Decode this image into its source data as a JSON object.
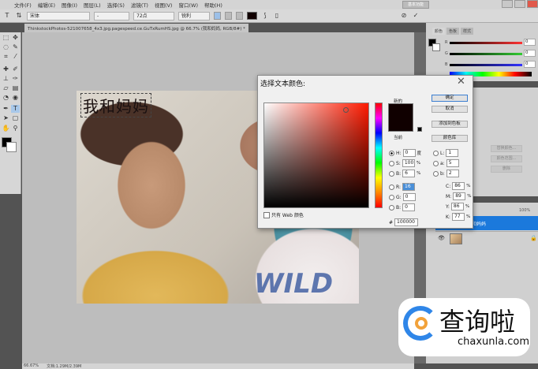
{
  "menu": [
    "文件(F)",
    "编辑(E)",
    "图像(I)",
    "图层(L)",
    "选择(S)",
    "滤镜(T)",
    "视图(V)",
    "窗口(W)",
    "帮助(H)"
  ],
  "workspace": "基本功能",
  "options": {
    "tool": "T",
    "font_family": "宋体",
    "font_style": "-",
    "font_size": "72点",
    "antialias": "锐利",
    "text_color": "#100000",
    "cancel_icon": "⊘",
    "commit_icon": "✓"
  },
  "document_tab": "ThinkstockPhotos-521007658_4x3.jpg.pagespeed.ce.GuTxRumHS.jpg @ 66.7% (我和妈妈, RGB/8#) *",
  "canvas": {
    "text_layer": "我和妈妈",
    "shirt_text": "WILD"
  },
  "status": {
    "zoom": "66.67%",
    "doc": "文档:1.29M/2.39M"
  },
  "color_panel": {
    "tabs": [
      "颜色",
      "色板",
      "样式"
    ],
    "R": "0",
    "G": "0",
    "B": "0"
  },
  "adjust_panel": {
    "buttons": [
      "替换颜色...",
      "颜色范围...",
      "删除"
    ]
  },
  "layers_panel": {
    "opacity": "100%",
    "fill": "100%",
    "active_layer": "我和妈妈"
  },
  "dialog": {
    "title": "选择文本颜色:",
    "close": "✕",
    "new_label": "新的",
    "current_label": "当前",
    "buttons": {
      "ok": "确定",
      "cancel": "取消",
      "add_swatch": "添加到色板",
      "libraries": "颜色库"
    },
    "hsb": [
      {
        "label": "H:",
        "value": "0",
        "unit": "度",
        "selected": true
      },
      {
        "label": "S:",
        "value": "100",
        "unit": "%"
      },
      {
        "label": "B:",
        "value": "6",
        "unit": "%"
      }
    ],
    "rgb": [
      {
        "label": "R:",
        "value": "16"
      },
      {
        "label": "G:",
        "value": "0"
      },
      {
        "label": "B:",
        "value": "0"
      }
    ],
    "lab": [
      {
        "label": "L:",
        "value": "1"
      },
      {
        "label": "a:",
        "value": "5"
      },
      {
        "label": "b:",
        "value": "2"
      }
    ],
    "cmyk": [
      {
        "label": "C:",
        "value": "86",
        "unit": "%"
      },
      {
        "label": "M:",
        "value": "89",
        "unit": "%"
      },
      {
        "label": "Y:",
        "value": "86",
        "unit": "%"
      },
      {
        "label": "K:",
        "value": "77",
        "unit": "%"
      }
    ],
    "web_only": "只有 Web 颜色",
    "hex_label": "#",
    "hex": "100000"
  },
  "watermark": {
    "brand": "查询啦",
    "url": "chaxunla.com"
  }
}
